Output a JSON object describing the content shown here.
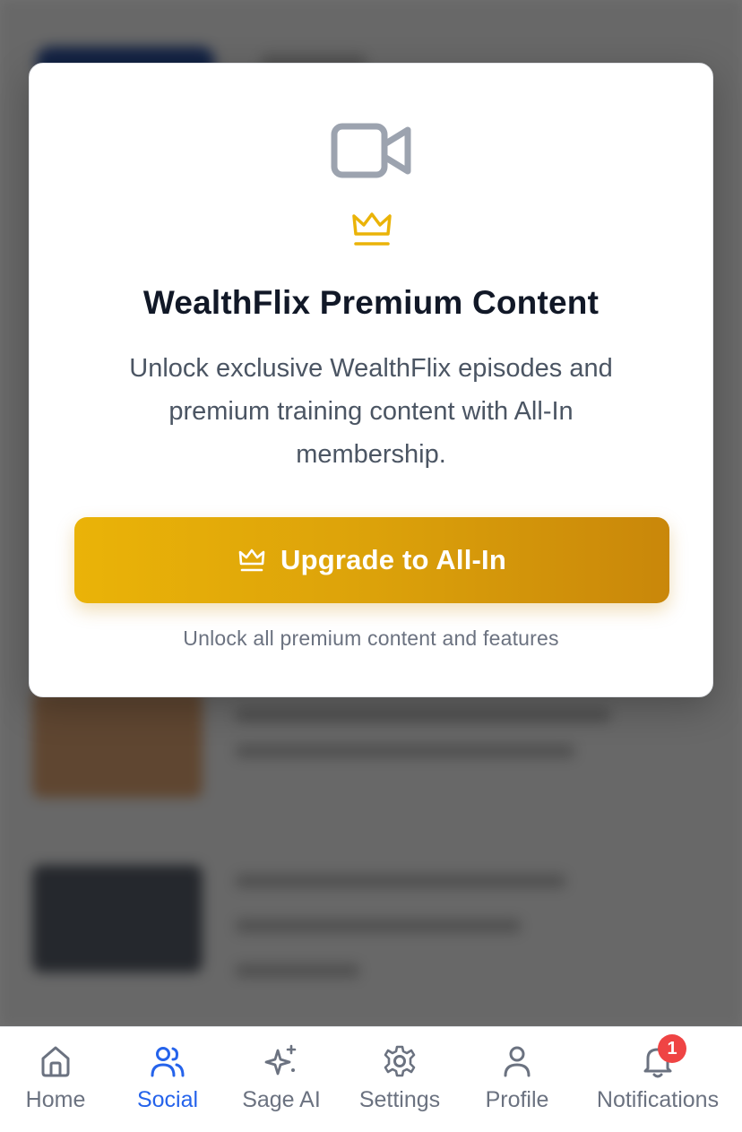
{
  "modal": {
    "video_icon": "video-camera-icon",
    "crown_icon": "crown-icon",
    "title": "WealthFlix Premium Content",
    "description": "Unlock exclusive WealthFlix episodes and premium training content with All-In membership.",
    "upgrade_button_label": "Upgrade to All-In",
    "note": "Unlock all premium content and features"
  },
  "nav": {
    "items": [
      {
        "label": "Home",
        "icon": "home-icon",
        "active": false
      },
      {
        "label": "Social",
        "icon": "users-icon",
        "active": true
      },
      {
        "label": "Sage AI",
        "icon": "sparkles-icon",
        "active": false
      },
      {
        "label": "Settings",
        "icon": "gear-icon",
        "active": false
      },
      {
        "label": "Profile",
        "icon": "user-icon",
        "active": false
      },
      {
        "label": "Notifications",
        "icon": "bell-icon",
        "active": false,
        "badge": "1"
      }
    ]
  },
  "colors": {
    "accent": "#2563eb",
    "gold": "#eab308",
    "badge": "#ef4444",
    "icon_gray": "#9ca3af"
  }
}
